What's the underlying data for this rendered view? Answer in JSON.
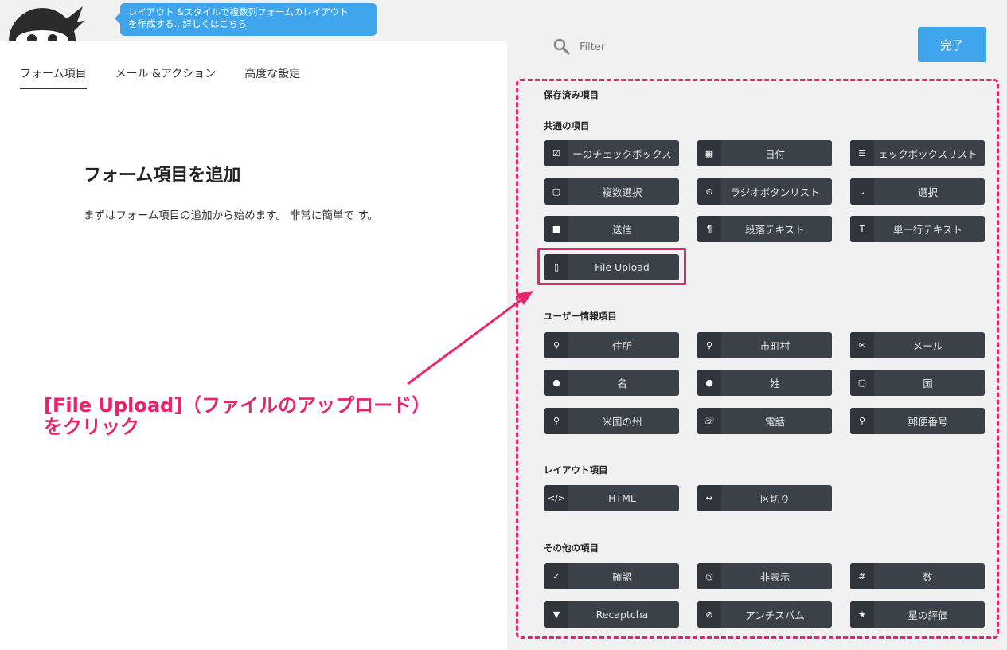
{
  "tooltip": {
    "line1": "レイアウト &スタイルで複数列フォームのレイアウト",
    "line2": "を作成する...詳しくはこちら"
  },
  "tabs": [
    "フォーム項目",
    "メール &アクション",
    "高度な設定"
  ],
  "empty_state": {
    "title": "フォーム項目を追加",
    "text": "まずはフォーム項目の追加から始めます。 非常に簡単で す。"
  },
  "filter": {
    "placeholder": "Filter"
  },
  "done_label": "完了",
  "sections": {
    "saved": "保存済み項目",
    "common": "共通の項目",
    "user": "ユーザー情報項目",
    "layout": "レイアウト項目",
    "other": "その他の項目"
  },
  "fields": {
    "common": [
      "ーのチェックボックス",
      "日付",
      "ェックボックスリスト",
      "複数選択",
      "ラジオボタンリスト",
      "選択",
      "送信",
      "段落テキスト",
      "単一行テキスト",
      "File Upload"
    ],
    "user": [
      "住所",
      "市町村",
      "メール",
      "名",
      "姓",
      "国",
      "米国の州",
      "電話",
      "郵便番号"
    ],
    "layout": [
      "HTML",
      "区切り"
    ],
    "other": [
      "確認",
      "非表示",
      "数",
      "Recaptcha",
      "アンチスパム",
      "星の評価"
    ]
  },
  "annotation": {
    "line1": "[File Upload]（ファイルのアップロード）",
    "line2": "をクリック"
  },
  "colors": {
    "accent": "#3fa6ee",
    "annotation": "#e8246c",
    "field_button": "#3b4148"
  }
}
